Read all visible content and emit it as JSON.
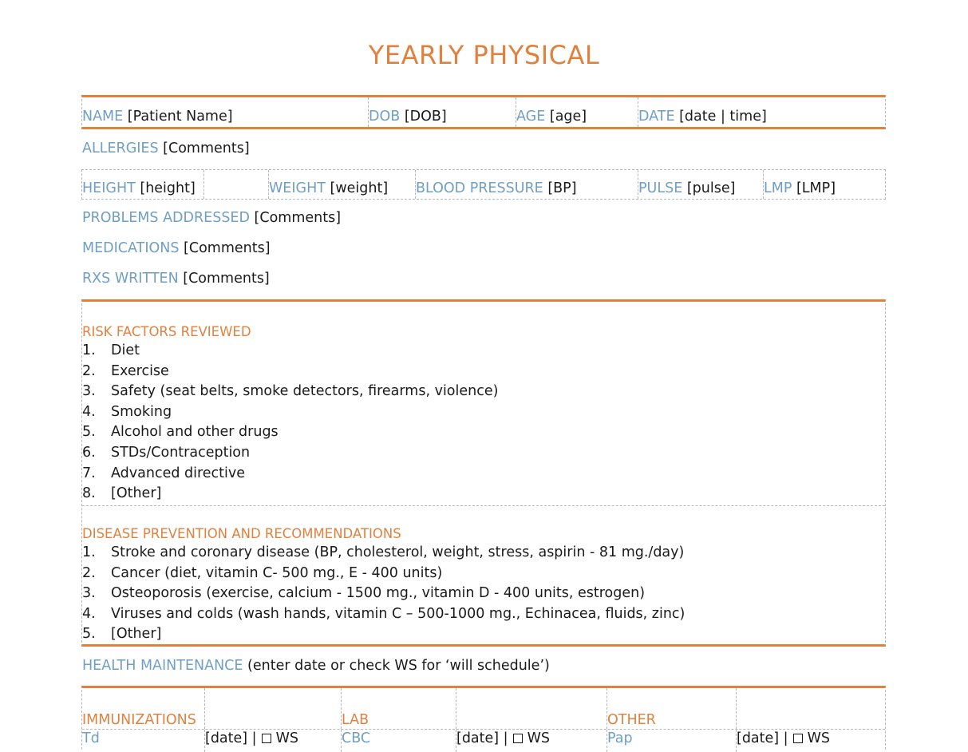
{
  "title": "YEARLY PHYSICAL",
  "header_row": [
    {
      "label": "NAME",
      "value": "[Patient Name]"
    },
    {
      "label": "DOB",
      "value": "[DOB]"
    },
    {
      "label": "AGE",
      "value": "[age]"
    },
    {
      "label": "DATE",
      "value": "[date | time]"
    }
  ],
  "allergies": {
    "label": "ALLERGIES",
    "value": "[Comments]"
  },
  "vitals_row": [
    {
      "label": "HEIGHT",
      "value": "[height]"
    },
    {
      "label": "",
      "value": ""
    },
    {
      "label": "WEIGHT",
      "value": "[weight]"
    },
    {
      "label": "BLOOD PRESSURE",
      "value": "[BP]"
    },
    {
      "label": "PULSE",
      "value": "[pulse]"
    },
    {
      "label": "LMP",
      "value": "[LMP]"
    }
  ],
  "problems": {
    "label": "PROBLEMS ADDRESSED",
    "value": "[Comments]"
  },
  "medications": {
    "label": "MEDICATIONS",
    "value": "[Comments]"
  },
  "rxs": {
    "label": "RXS WRITTEN",
    "value": "[Comments]"
  },
  "risk_factors": {
    "heading": "RISK FACTORS REVIEWED",
    "items": [
      {
        "num": "1.",
        "text": "Diet"
      },
      {
        "num": "2.",
        "text": "Exercise"
      },
      {
        "num": "3.",
        "text": "Safety (seat belts, smoke detectors, firearms, violence)"
      },
      {
        "num": "4.",
        "text": "Smoking"
      },
      {
        "num": "5.",
        "text": "Alcohol and other drugs"
      },
      {
        "num": "6.",
        "text": "STDs/Contraception"
      },
      {
        "num": "7.",
        "text": "Advanced directive"
      },
      {
        "num": "8.",
        "text": "[Other]"
      }
    ]
  },
  "disease_prevention": {
    "heading": "DISEASE PREVENTION AND RECOMMENDATIONS",
    "items": [
      {
        "num": "1.",
        "text": "Stroke and coronary disease (BP, cholesterol, weight, stress, aspirin - 81 mg./day)"
      },
      {
        "num": "2.",
        "text": "Cancer (diet, vitamin C- 500 mg., E - 400 units)"
      },
      {
        "num": "3.",
        "text": "Osteoporosis (exercise, calcium - 1500 mg., vitamin D - 400 units, estrogen)"
      },
      {
        "num": "4.",
        "text": "Viruses and colds (wash hands, vitamin C – 500-1000 mg., Echinacea, fluids, zinc)"
      },
      {
        "num": "5.",
        "text": "[Other]"
      }
    ]
  },
  "health_maintenance": {
    "label": "HEALTH MAINTENANCE",
    "note": "(enter date or check WS for ‘will schedule’)"
  },
  "maintenance_table": {
    "headers": [
      "IMMUNIZATIONS",
      "",
      "LAB",
      "",
      "OTHER",
      ""
    ],
    "rows": [
      [
        {
          "item": "Td",
          "date": "[date] |",
          "check_label": "WS"
        },
        {
          "item": "CBC",
          "date": "[date] |",
          "check_label": "WS"
        },
        {
          "item": "Pap",
          "date": "[date] |",
          "check_label": "WS"
        }
      ]
    ]
  }
}
